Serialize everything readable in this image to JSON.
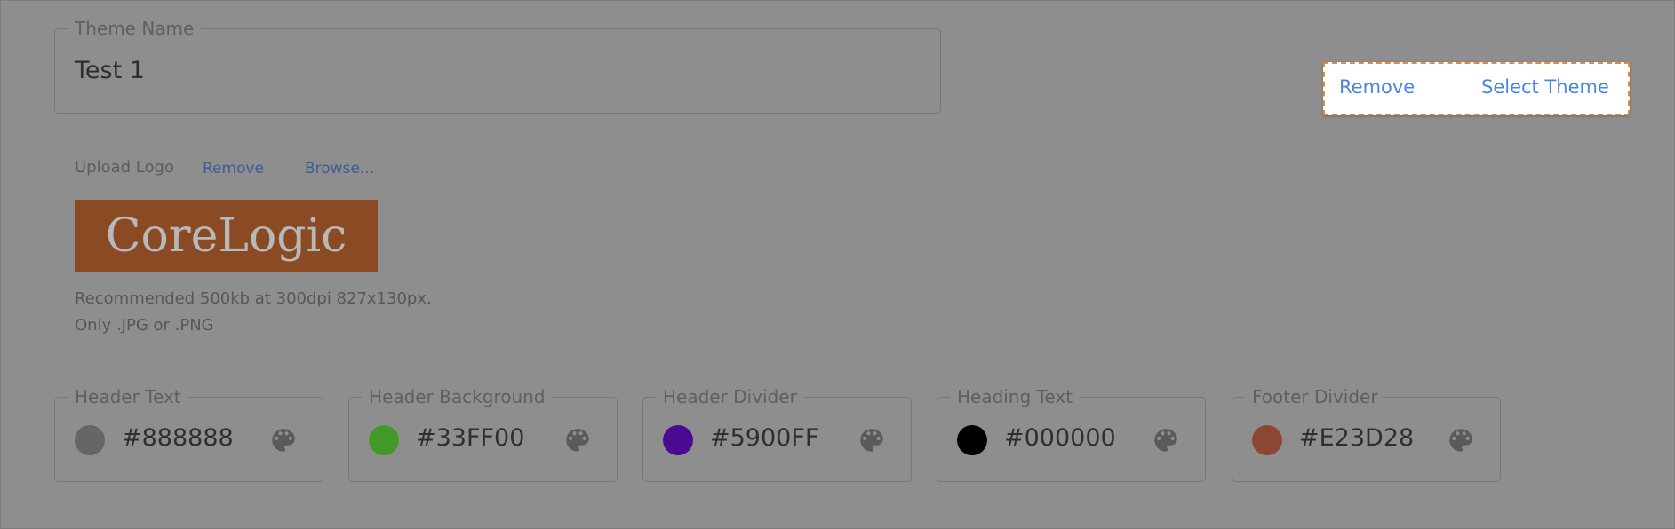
{
  "theme_name": {
    "legend": "Theme Name",
    "value": "Test 1"
  },
  "actions": {
    "remove_label": "Remove",
    "select_theme_label": "Select Theme"
  },
  "upload": {
    "label": "Upload Logo",
    "remove_label": "Remove",
    "browse_label": "Browse...",
    "logo_text": "CoreLogic",
    "hint_line1": "Recommended 500kb at 300dpi 827x130px.",
    "hint_line2": "Only .JPG or .PNG"
  },
  "colors": [
    {
      "label": "Header Text",
      "hex": "#888888",
      "swatch": "#666666"
    },
    {
      "label": "Header Background",
      "hex": "#33FF00",
      "swatch": "#43982a"
    },
    {
      "label": "Header Divider",
      "hex": "#5900FF",
      "swatch": "#4a0a92"
    },
    {
      "label": "Heading Text",
      "hex": "#000000",
      "swatch": "#000000"
    },
    {
      "label": "Footer Divider",
      "hex": "#E23D28",
      "swatch": "#8c4733"
    }
  ],
  "icons": {
    "palette": "palette-icon"
  },
  "style": {
    "link_color": "#4a86e0",
    "highlight_border": "#e48a3a",
    "logo_background": "#8a4a23"
  }
}
